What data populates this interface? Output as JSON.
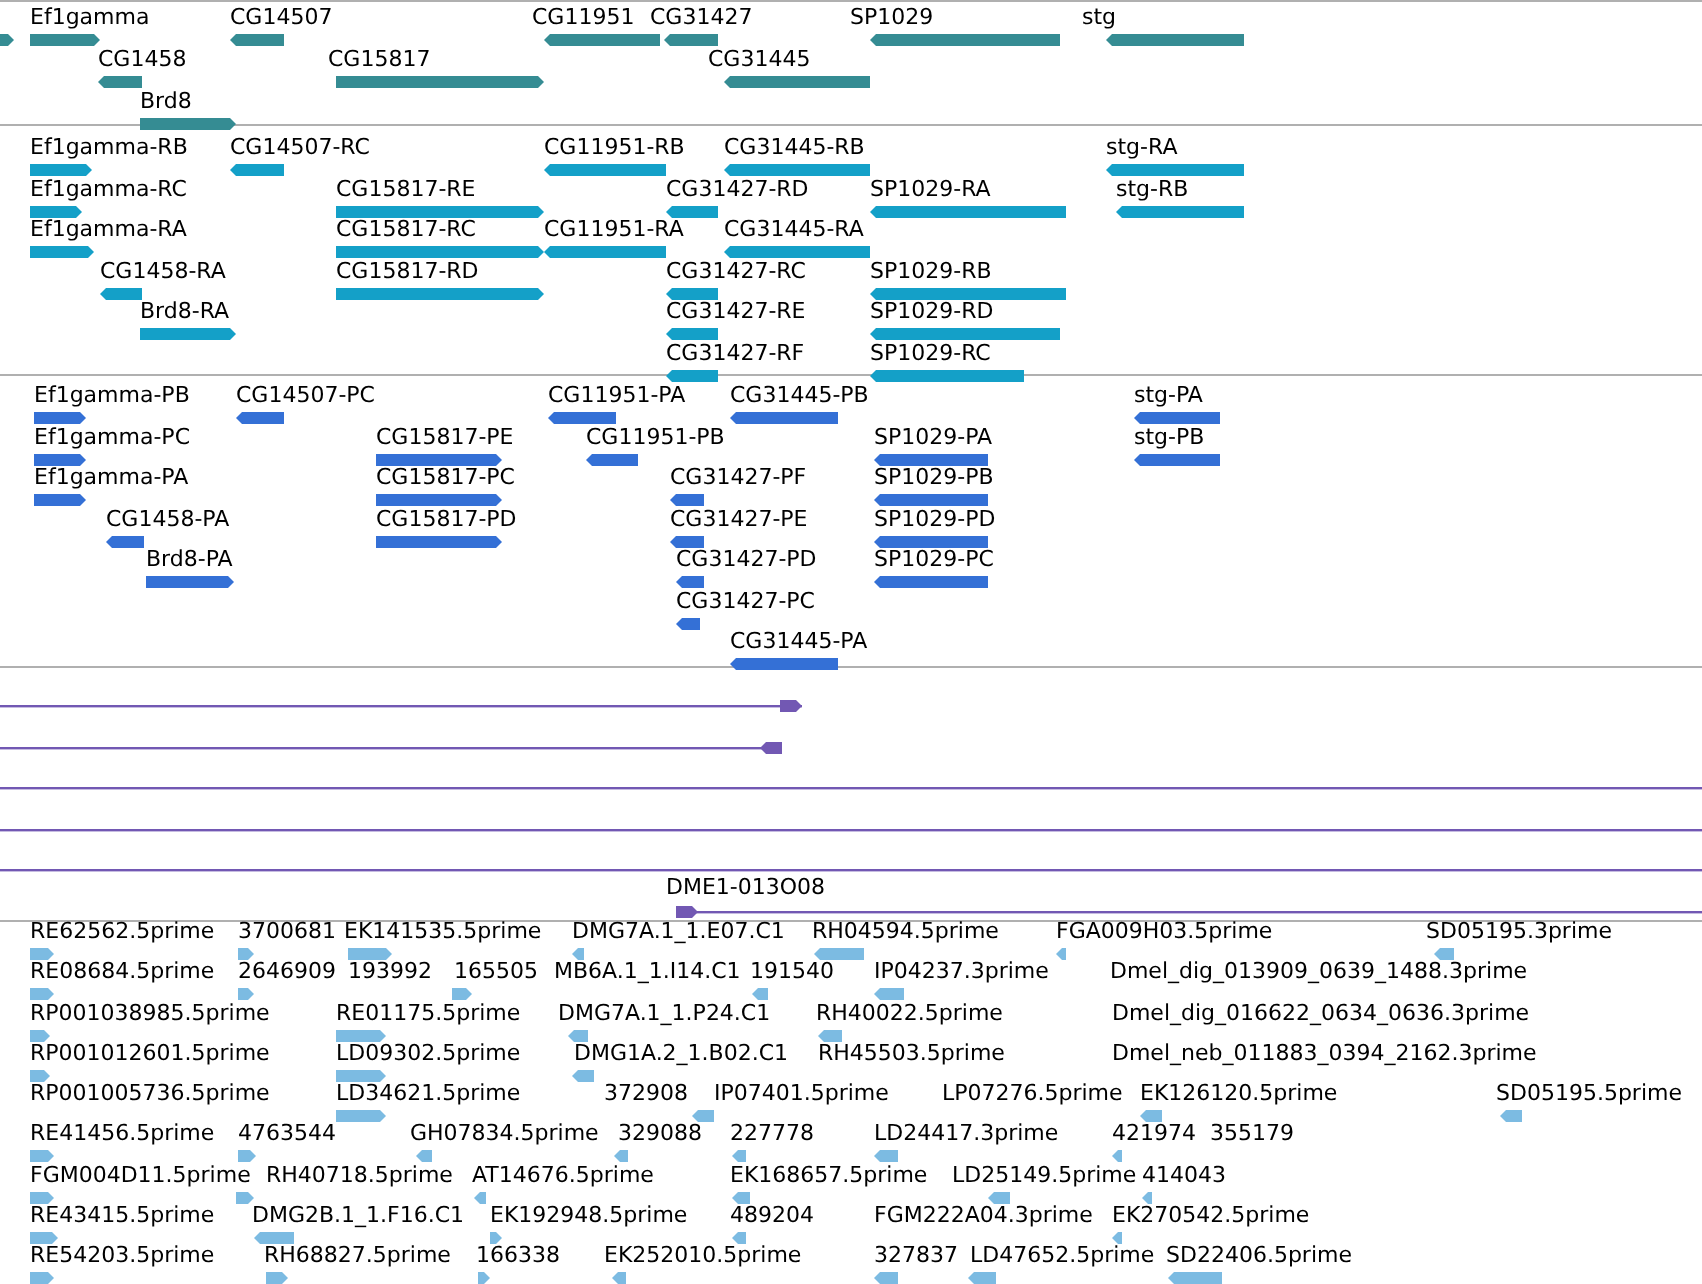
{
  "tracks": [
    {
      "kind": "gene",
      "features": [
        {
          "reverse": false
        },
        {
          "label": "Ef1gamma",
          "reverse": false
        },
        {
          "label": "CG14507",
          "reverse": true
        },
        {
          "label": "CG11951",
          "reverse": true
        },
        {
          "label": "CG31427",
          "reverse": true
        },
        {
          "label": "SP1029",
          "reverse": true
        },
        {
          "label": "stg",
          "reverse": true
        },
        {
          "label": "CG1458",
          "reverse": true
        },
        {
          "label": "CG15817",
          "reverse": false
        },
        {
          "label": "CG31445",
          "reverse": true
        },
        {
          "label": "Brd8",
          "reverse": false
        }
      ]
    },
    {
      "kind": "transcript",
      "features": [
        {
          "label": "Ef1gamma-RB",
          "reverse": false
        },
        {
          "label": "CG14507-RC",
          "reverse": true
        },
        {
          "label": "CG11951-RB",
          "reverse": true
        },
        {
          "label": "CG31445-RB",
          "reverse": true
        },
        {
          "label": "stg-RA",
          "reverse": true
        },
        {
          "label": "Ef1gamma-RC",
          "reverse": false
        },
        {
          "label": "CG15817-RE",
          "reverse": false
        },
        {
          "label": "CG31427-RD",
          "reverse": true
        },
        {
          "label": "SP1029-RA",
          "reverse": true
        },
        {
          "label": "stg-RB",
          "reverse": true
        },
        {
          "label": "Ef1gamma-RA",
          "reverse": false
        },
        {
          "label": "CG15817-RC",
          "reverse": false
        },
        {
          "label": "CG11951-RA",
          "reverse": true
        },
        {
          "label": "CG31445-RA",
          "reverse": true
        },
        {
          "label": "CG1458-RA",
          "reverse": true
        },
        {
          "label": "CG15817-RD",
          "reverse": false
        },
        {
          "label": "CG31427-RC",
          "reverse": true
        },
        {
          "label": "SP1029-RB",
          "reverse": true
        },
        {
          "label": "Brd8-RA",
          "reverse": false
        },
        {
          "label": "CG31427-RE",
          "reverse": true
        },
        {
          "label": "SP1029-RD",
          "reverse": true
        },
        {
          "label": "CG31427-RF",
          "reverse": true
        },
        {
          "label": "SP1029-RC",
          "reverse": true
        }
      ]
    },
    {
      "kind": "protein",
      "features": [
        {
          "label": "Ef1gamma-PB",
          "reverse": false
        },
        {
          "label": "CG14507-PC",
          "reverse": true
        },
        {
          "label": "CG11951-PA",
          "reverse": true
        },
        {
          "label": "CG31445-PB",
          "reverse": true
        },
        {
          "label": "stg-PA",
          "reverse": true
        },
        {
          "label": "Ef1gamma-PC",
          "reverse": false
        },
        {
          "label": "CG15817-PE",
          "reverse": false
        },
        {
          "label": "CG11951-PB",
          "reverse": true
        },
        {
          "label": "SP1029-PA",
          "reverse": true
        },
        {
          "label": "stg-PB",
          "reverse": true
        },
        {
          "label": "Ef1gamma-PA",
          "reverse": false
        },
        {
          "label": "CG15817-PC",
          "reverse": false
        },
        {
          "label": "CG31427-PF",
          "reverse": true
        },
        {
          "label": "SP1029-PB",
          "reverse": true
        },
        {
          "label": "CG1458-PA",
          "reverse": true
        },
        {
          "label": "CG15817-PD",
          "reverse": false
        },
        {
          "label": "CG31427-PE",
          "reverse": true
        },
        {
          "label": "SP1029-PD",
          "reverse": true
        },
        {
          "label": "Brd8-PA",
          "reverse": false
        },
        {
          "label": "CG31427-PD",
          "reverse": true
        },
        {
          "label": "SP1029-PC",
          "reverse": true
        },
        {
          "label": "CG31427-PC",
          "reverse": true
        },
        {
          "label": "CG31445-PA",
          "reverse": true
        }
      ]
    },
    {
      "kind": "alignment",
      "features": [
        {
          "kind": "alignment",
          "reverse": false
        },
        {
          "kind": "alignment",
          "reverse": true
        },
        {
          "kind": "span"
        },
        {
          "kind": "span"
        },
        {
          "kind": "span"
        },
        {
          "kind": "alignment",
          "label": "DME1-013O08",
          "reverse": false
        }
      ]
    },
    {
      "kind": "est",
      "features": [
        {
          "label": "RE62562.5prime",
          "reverse": false
        },
        {
          "label": "3700681",
          "reverse": false
        },
        {
          "label": "EK141535.5prime",
          "reverse": false
        },
        {
          "label": "DMG7A.1_1.E07.C1",
          "reverse": true
        },
        {
          "label": "RH04594.5prime",
          "reverse": true
        },
        {
          "label": "FGA009H03.5prime",
          "reverse": true
        },
        {
          "label": "SD05195.3prime",
          "reverse": true
        },
        {
          "label": "RE08684.5prime",
          "reverse": false
        },
        {
          "label": "2646909",
          "reverse": false
        },
        {
          "label": "193992"
        },
        {
          "label": "165505",
          "reverse": false
        },
        {
          "label": "MB6A.1_1.I14.C1"
        },
        {
          "label": "191540",
          "reverse": true
        },
        {
          "label": "IP04237.3prime",
          "reverse": true
        },
        {
          "label": "Dmel_dig_013909_0639_1488.3prime"
        },
        {
          "label": "RP001038985.5prime",
          "reverse": false
        },
        {
          "label": "RE01175.5prime",
          "reverse": false
        },
        {
          "label": "DMG7A.1_1.P24.C1",
          "reverse": true
        },
        {
          "label": "RH40022.5prime",
          "reverse": true
        },
        {
          "label": "Dmel_dig_016622_0634_0636.3prime"
        },
        {
          "label": "RP001012601.5prime",
          "reverse": false
        },
        {
          "label": "LD09302.5prime",
          "reverse": false
        },
        {
          "label": "DMG1A.2_1.B02.C1",
          "reverse": true
        },
        {
          "label": "RH45503.5prime"
        },
        {
          "label": "Dmel_neb_011883_0394_2162.3prime"
        },
        {
          "label": "RP001005736.5prime"
        },
        {
          "label": "LD34621.5prime",
          "reverse": false
        },
        {
          "label": "372908"
        },
        {
          "label": "IP07401.5prime",
          "reverse": true
        },
        {
          "label": "LP07276.5prime"
        },
        {
          "label": "EK126120.5prime",
          "reverse": true
        },
        {
          "label": "SD05195.5prime",
          "reverse": true
        },
        {
          "label": "RE41456.5prime",
          "reverse": false
        },
        {
          "label": "4763544",
          "reverse": false
        },
        {
          "label": "GH07834.5prime",
          "reverse": true
        },
        {
          "label": "329088",
          "reverse": true
        },
        {
          "label": "227778",
          "reverse": true
        },
        {
          "label": "LD24417.3prime",
          "reverse": true
        },
        {
          "label": "421974",
          "reverse": true
        },
        {
          "label": "355179"
        },
        {
          "label": "FGM004D11.5prime",
          "reverse": false
        },
        {
          "label": "RH40718.5prime",
          "reverse": false
        },
        {
          "label": "AT14676.5prime",
          "reverse": true
        },
        {
          "label": "EK168657.5prime",
          "reverse": true
        },
        {
          "label": "LD25149.5prime",
          "reverse": true
        },
        {
          "label": "414043",
          "reverse": true
        },
        {
          "label": "RE43415.5prime",
          "reverse": false
        },
        {
          "label": "DMG2B.1_1.F16.C1",
          "reverse": true
        },
        {
          "label": "EK192948.5prime",
          "reverse": false
        },
        {
          "label": "489204",
          "reverse": true
        },
        {
          "label": "FGM222A04.3prime"
        },
        {
          "label": "EK270542.5prime",
          "reverse": true
        },
        {
          "label": "RE54203.5prime",
          "reverse": false
        },
        {
          "label": "RH68827.5prime",
          "reverse": false
        },
        {
          "label": "166338",
          "reverse": false
        },
        {
          "label": "EK252010.5prime",
          "reverse": true
        },
        {
          "label": "327837",
          "reverse": true
        },
        {
          "label": "LD47652.5prime",
          "reverse": true
        },
        {
          "label": "SD22406.5prime",
          "reverse": true
        }
      ]
    }
  ]
}
